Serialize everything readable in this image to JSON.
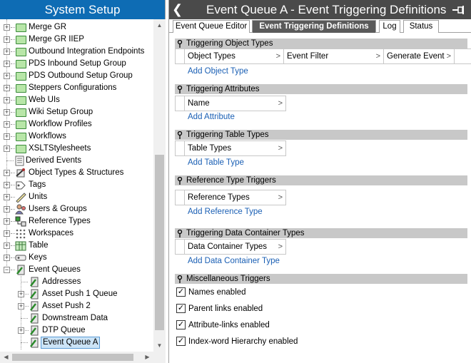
{
  "left_panel": {
    "title": "System Setup",
    "tree": [
      {
        "label": "Merge GR",
        "icon": "folder-icon",
        "expander": "+"
      },
      {
        "label": "Merge GR IIEP",
        "icon": "folder-icon",
        "expander": "+"
      },
      {
        "label": "Outbound Integration Endpoints",
        "icon": "folder-icon",
        "expander": "+"
      },
      {
        "label": "PDS Inbound Setup Group",
        "icon": "folder-icon",
        "expander": "+"
      },
      {
        "label": "PDS Outbound Setup Group",
        "icon": "folder-icon",
        "expander": "+"
      },
      {
        "label": "Steppers Configurations",
        "icon": "folder-icon",
        "expander": "+"
      },
      {
        "label": "Web UIs",
        "icon": "folder-icon",
        "expander": "+"
      },
      {
        "label": "Wiki Setup Group",
        "icon": "folder-icon",
        "expander": "+"
      },
      {
        "label": "Workflow Profiles",
        "icon": "folder-icon",
        "expander": "+"
      },
      {
        "label": "Workflows",
        "icon": "folder-icon",
        "expander": "+"
      },
      {
        "label": "XSLTStylesheets",
        "icon": "folder-icon",
        "expander": "+"
      },
      {
        "label": "Derived Events",
        "icon": "list-icon",
        "expander": ""
      },
      {
        "label": "Object Types & Structures",
        "icon": "object-types-icon",
        "expander": "+"
      },
      {
        "label": "Tags",
        "icon": "tag-icon",
        "expander": "+"
      },
      {
        "label": "Units",
        "icon": "ruler-icon",
        "expander": "+"
      },
      {
        "label": "Users & Groups",
        "icon": "users-icon",
        "expander": "+"
      },
      {
        "label": "Reference Types",
        "icon": "reference-icon",
        "expander": "+"
      },
      {
        "label": "Workspaces",
        "icon": "workspace-icon",
        "expander": "+"
      },
      {
        "label": "Table",
        "icon": "table-icon",
        "expander": "+"
      },
      {
        "label": "Keys",
        "icon": "key-icon",
        "expander": "+"
      },
      {
        "label": "Event Queues",
        "icon": "queue-icon",
        "expander": "−"
      },
      {
        "label": "Addresses",
        "icon": "queue-icon",
        "expander": ""
      },
      {
        "label": "Asset Push 1 Queue",
        "icon": "queue-icon",
        "expander": "+"
      },
      {
        "label": "Asset Push 2",
        "icon": "queue-icon",
        "expander": "+"
      },
      {
        "label": "Downstream Data",
        "icon": "queue-icon",
        "expander": ""
      },
      {
        "label": "DTP Queue",
        "icon": "queue-icon",
        "expander": "+"
      },
      {
        "label": "Event Queue A",
        "icon": "queue-icon",
        "expander": "",
        "selected": true
      }
    ]
  },
  "right_panel": {
    "title": "Event Queue A - Event Triggering Definitions",
    "tabs": [
      {
        "label": "Event Queue Editor",
        "active": false
      },
      {
        "label": "Event Triggering Definitions",
        "active": true
      },
      {
        "label": "Log",
        "active": false
      },
      {
        "label": "Status",
        "active": false
      }
    ],
    "sections": {
      "object_types": {
        "title": "Triggering Object Types",
        "columns": [
          "Object Types",
          "Event Filter",
          "Generate Event"
        ],
        "add_link": "Add Object Type"
      },
      "attributes": {
        "title": "Triggering Attributes",
        "columns": [
          "Name"
        ],
        "add_link": "Add Attribute"
      },
      "table_types": {
        "title": "Triggering Table Types",
        "columns": [
          "Table Types"
        ],
        "add_link": "Add Table Type"
      },
      "reference_types": {
        "title": "Reference Type Triggers",
        "columns": [
          "Reference Types"
        ],
        "add_link": "Add Reference Type"
      },
      "data_container_types": {
        "title": "Triggering Data Container Types",
        "columns": [
          "Data Container Types"
        ],
        "add_link": "Add Data Container Type"
      },
      "misc": {
        "title": "Miscellaneous Triggers",
        "checkboxes": [
          {
            "label": "Names enabled",
            "checked": true
          },
          {
            "label": "Parent links enabled",
            "checked": true
          },
          {
            "label": "Attribute-links enabled",
            "checked": true
          },
          {
            "label": "Index-word Hierarchy enabled",
            "checked": true
          }
        ]
      }
    }
  },
  "colors": {
    "left_title_bg": "#0e6cb4",
    "right_title_bg": "#4a4a4a",
    "section_header_bg": "#c8c8c8",
    "link": "#1a5fb4",
    "selection": "#cce4f7"
  }
}
